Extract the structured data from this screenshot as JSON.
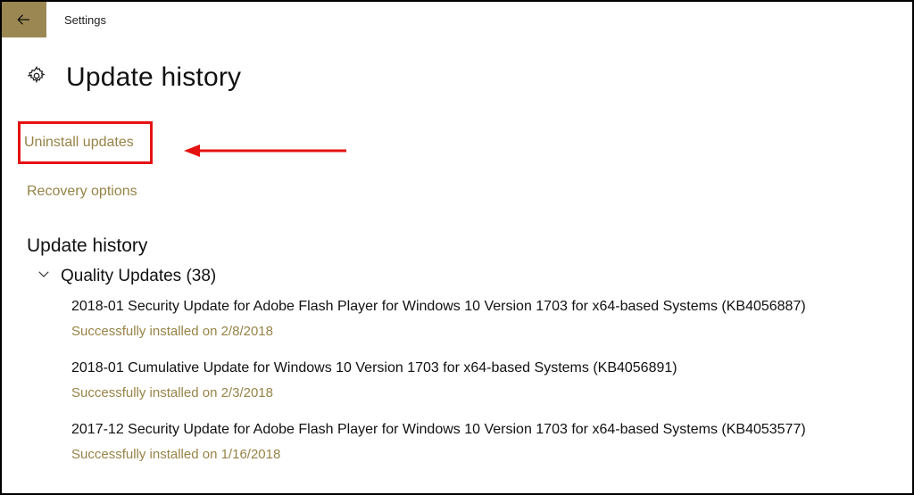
{
  "titlebar": {
    "app_name": "Settings"
  },
  "page": {
    "title": "Update history"
  },
  "links": {
    "uninstall": "Uninstall updates",
    "recovery": "Recovery options"
  },
  "section": {
    "heading": "Update history"
  },
  "group": {
    "name": "Quality Updates",
    "count": "(38)"
  },
  "updates": [
    {
      "title": "2018-01 Security Update for Adobe Flash Player for Windows 10 Version 1703 for x64-based Systems (KB4056887)",
      "status": "Successfully installed on 2/8/2018"
    },
    {
      "title": "2018-01 Cumulative Update for Windows 10 Version 1703 for x64-based Systems (KB4056891)",
      "status": "Successfully installed on 2/3/2018"
    },
    {
      "title": "2017-12 Security Update for Adobe Flash Player for Windows 10 Version 1703 for x64-based Systems (KB4053577)",
      "status": "Successfully installed on 1/16/2018"
    }
  ]
}
